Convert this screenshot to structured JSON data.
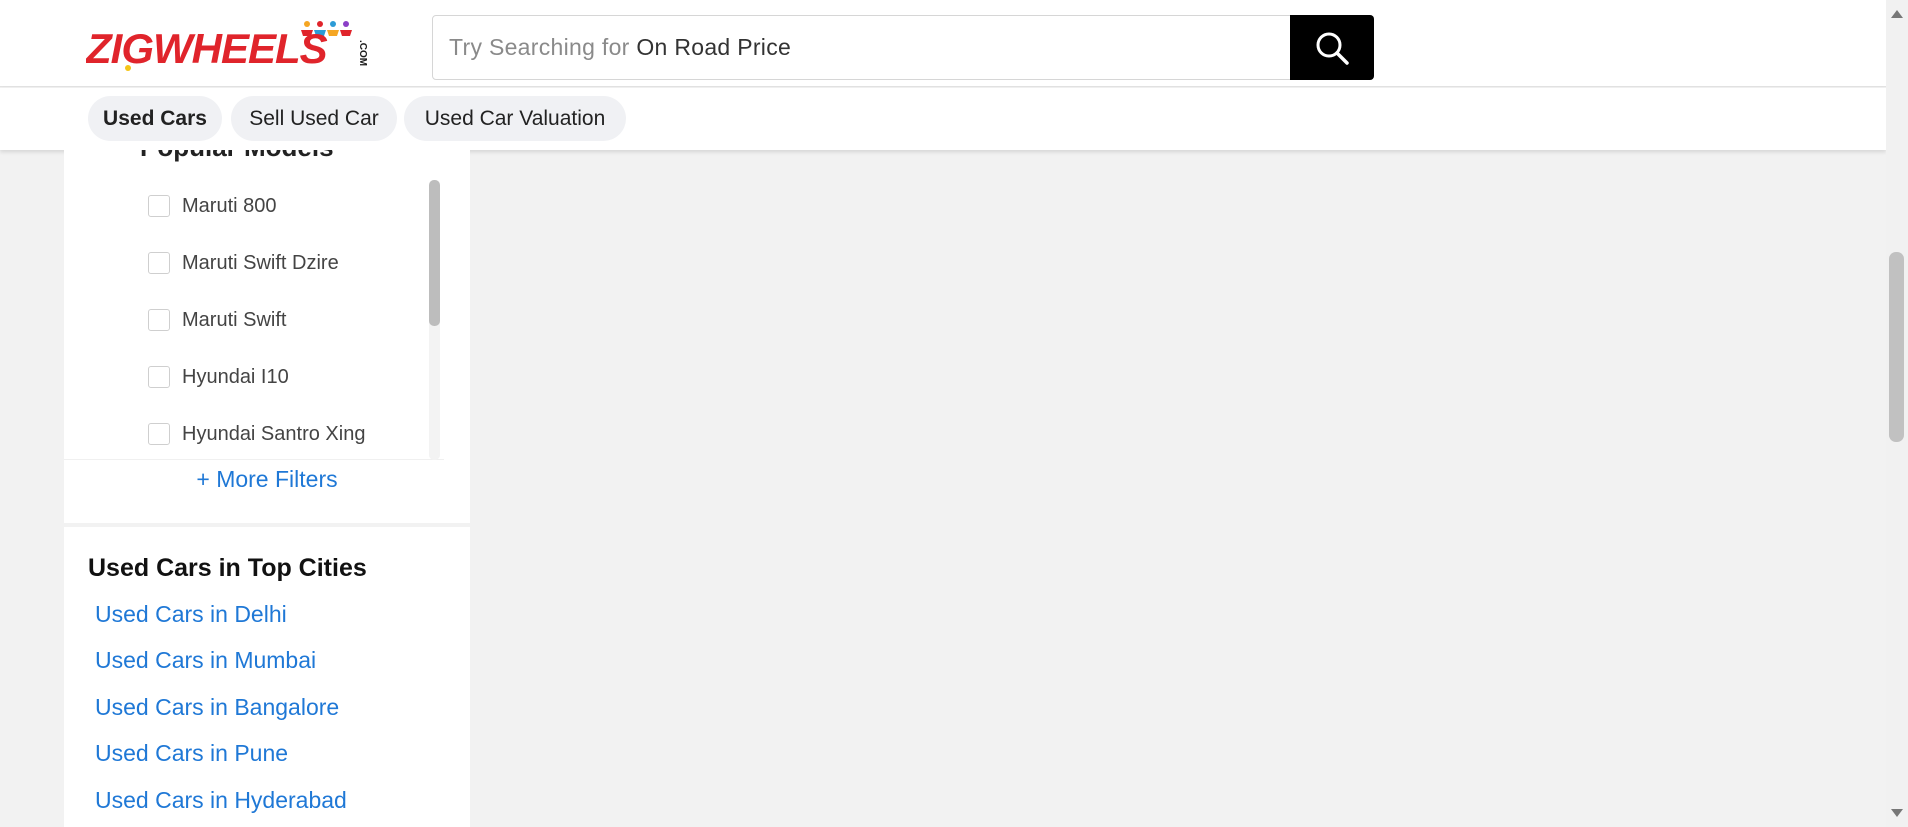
{
  "header": {
    "logo_text": "ZIGWHEELS",
    "logo_suffix": ".COM",
    "search": {
      "placeholder_prefix": "Try Searching for",
      "placeholder_highlight": "On Road Price"
    }
  },
  "subnav": {
    "tabs": [
      {
        "label": "Used Cars",
        "active": true
      },
      {
        "label": "Sell Used Car",
        "active": false
      },
      {
        "label": "Used Car Valuation",
        "active": false
      }
    ]
  },
  "filters": {
    "section_title": "Popular Models",
    "models": [
      "Maruti 800",
      "Maruti Swift Dzire",
      "Maruti Swift",
      "Hyundai I10",
      "Hyundai Santro Xing"
    ],
    "more_filters": "+ More Filters"
  },
  "top_cities": {
    "title": "Used Cars in Top Cities",
    "links": [
      "Used Cars in Delhi",
      "Used Cars in Mumbai",
      "Used Cars in Bangalore",
      "Used Cars in Pune",
      "Used Cars in Hyderabad"
    ]
  },
  "colors": {
    "link": "#1f78d6",
    "search_button": "#000000",
    "logo_red": "#e0242b",
    "logo_dark": "#1a1a1a"
  }
}
